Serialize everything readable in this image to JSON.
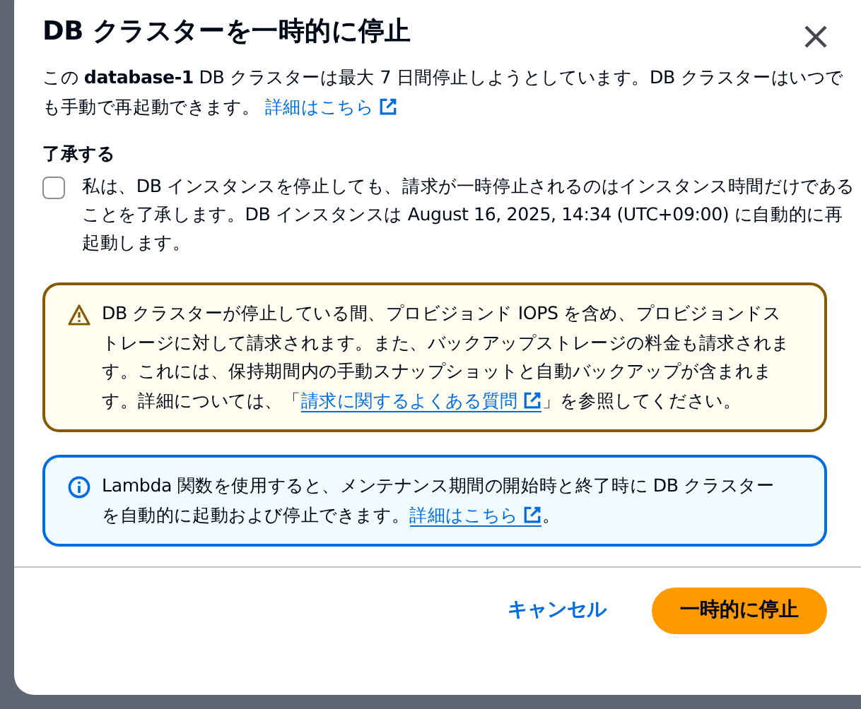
{
  "dialog": {
    "title": "DB クラスターを一時的に停止",
    "intro": {
      "text": "この **database-1** DB クラスターは最大 7 日間停止しようとしています。DB クラスターはいつでも手動で再起動できます。",
      "link": "詳細はこちら"
    },
    "acknowledge": {
      "heading": "了承する",
      "checked": false,
      "text": "私は、DB インスタンスを停止しても、請求が一時停止されるのはインスタンス時間だけであることを了承します。DB インスタンスは August 16, 2025, 14:34 (UTC+09:00) に自動的に再起動します。"
    },
    "alerts": [
      {
        "kind": "warning",
        "text": "DB クラスターが停止している間、プロビジョンド IOPS を含め、プロビジョンドストレージに対して請求されます。また、バックアップストレージの料金も請求されます。これには、保持期間内の手動スナップショットと自動バックアップが含まれます。詳細については、「",
        "link": "請求に関するよくある質問",
        "text_after": "」を参照してください。"
      },
      {
        "kind": "info",
        "text": "Lambda 関数を使用すると、メンテナンス期間の開始時と終了時に DB クラスターを自動的に起動および停止できます。",
        "link": "詳細はこちら",
        "text_after": "。"
      }
    ],
    "buttons": [
      {
        "label": "キャンセル",
        "kind": "link"
      },
      {
        "label": "一時的に停止",
        "kind": "primary"
      }
    ]
  }
}
